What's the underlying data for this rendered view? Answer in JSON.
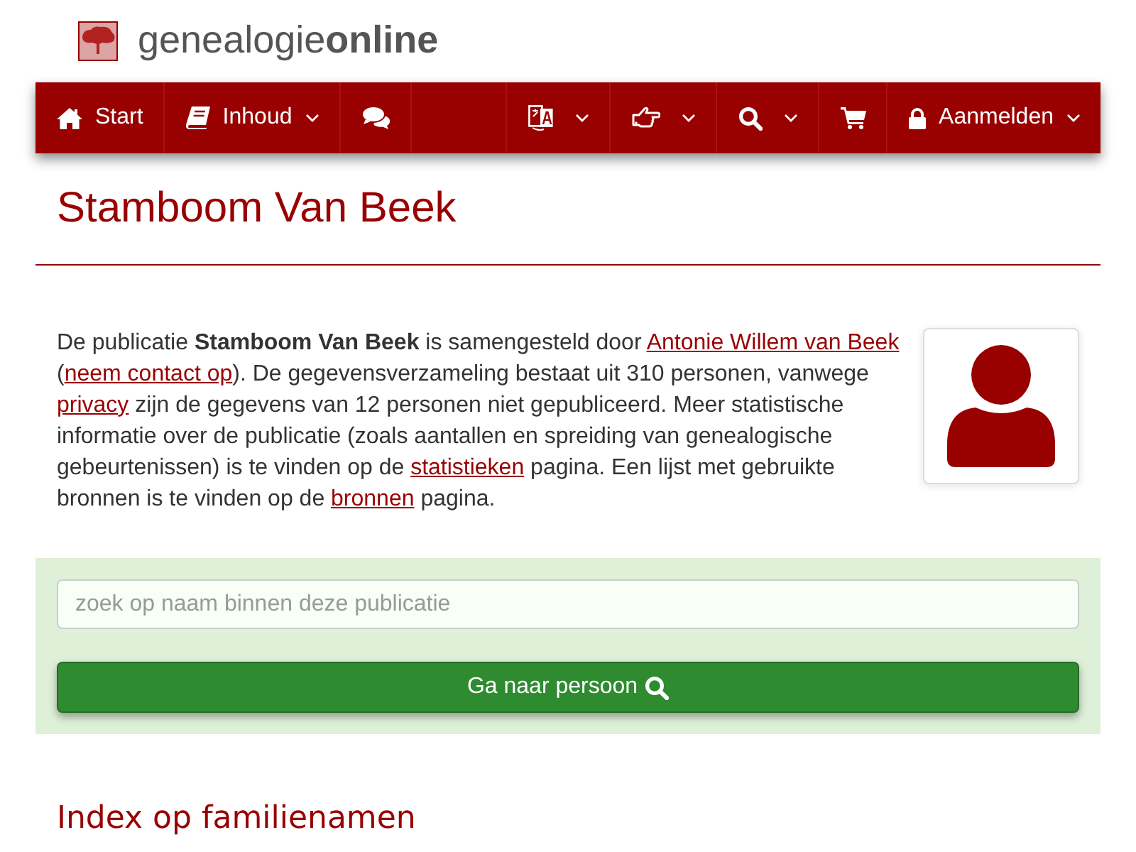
{
  "logo": {
    "text": "genealogie**online**"
  },
  "nav": {
    "left_items": [
      {
        "kind": "home",
        "label": "Start",
        "dropdown": false
      },
      {
        "kind": "book",
        "label": "Inhoud",
        "dropdown": true
      },
      {
        "kind": "chat",
        "dropdown": false
      }
    ],
    "right_items": [
      {
        "kind": "translate",
        "dropdown": true
      },
      {
        "kind": "hand",
        "dropdown": true
      },
      {
        "kind": "search",
        "dropdown": true
      },
      {
        "kind": "cart",
        "dropdown": false
      },
      {
        "kind": "lock",
        "label": "Aanmelden",
        "dropdown": true
      }
    ]
  },
  "page": {
    "title": "Stamboom Van Beek",
    "intro": [
      {
        "kind": "text",
        "text": "De publicatie **Stamboom Van Beek** is samengesteld door "
      },
      {
        "kind": "link",
        "text": "Antonie Willem van Beek"
      },
      {
        "kind": "text",
        "text": " ("
      },
      {
        "kind": "link",
        "text": "neem contact op"
      },
      {
        "kind": "text",
        "text": "). De gegevensverzameling bestaat uit 310 personen, vanwege "
      },
      {
        "kind": "link",
        "text": "privacy"
      },
      {
        "kind": "text",
        "text": " zijn de gegevens van 12 personen niet gepubliceerd. Meer statistische informatie over de publicatie (zoals aantallen en spreiding van genealogische gebeurtenissen) is te vinden op de "
      },
      {
        "kind": "link",
        "text": "statistieken"
      },
      {
        "kind": "text",
        "text": " pagina. Een lijst met gebruikte bronnen is te vinden op de "
      },
      {
        "kind": "link",
        "text": "bronnen"
      },
      {
        "kind": "text",
        "text": " pagina."
      }
    ]
  },
  "search": {
    "placeholder": "zoek op naam binnen deze publicatie",
    "button": "Ga naar persoon"
  },
  "section_heading": "Index op familienamen"
}
